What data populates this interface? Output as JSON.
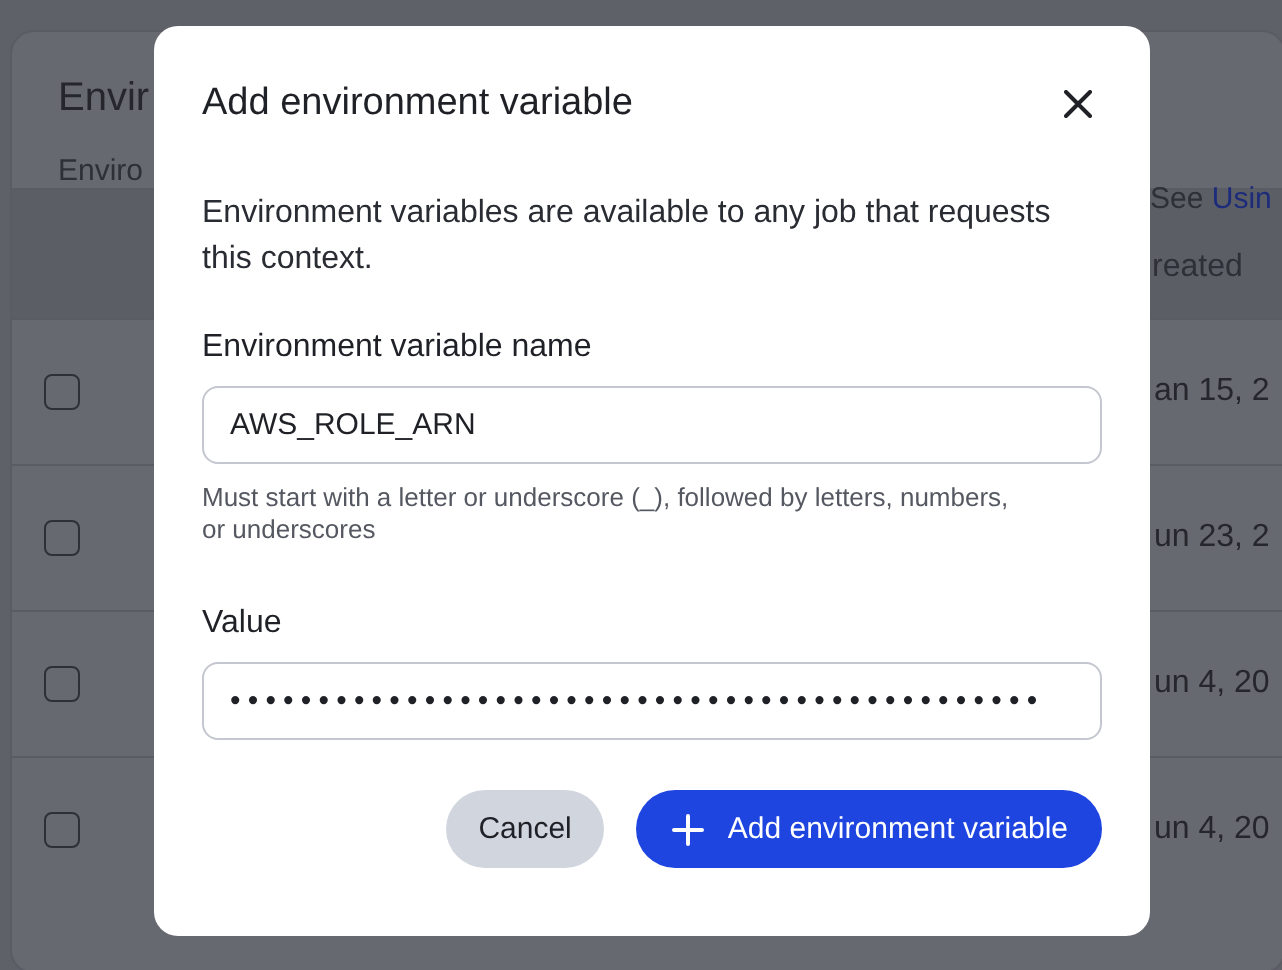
{
  "background": {
    "title": "Envir",
    "subtitle": "Enviro",
    "see_text": "See",
    "see_link": "Usin",
    "created_header": "reated",
    "rows": [
      {
        "checked": false,
        "created": "an 15, 2"
      },
      {
        "checked": false,
        "created": "un 23, 2"
      },
      {
        "checked": false,
        "created": "un 4, 20"
      },
      {
        "checked": false,
        "created": "un 4, 20"
      }
    ]
  },
  "dialog": {
    "title": "Add environment variable",
    "description": "Environment variables are available to any job that requests this context.",
    "fields": [
      {
        "label": "Environment variable name",
        "value": "AWS_ROLE_ARN",
        "hint": "Must start with a letter or underscore (_), followed by letters, numbers, or underscores"
      },
      {
        "label": "Value",
        "value": "••••••••••••••••••••••••••••••••••••••••••••••"
      }
    ],
    "buttons": [
      {
        "kind": "secondary",
        "label": "Cancel"
      },
      {
        "kind": "primary",
        "label": "Add environment variable"
      }
    ]
  }
}
